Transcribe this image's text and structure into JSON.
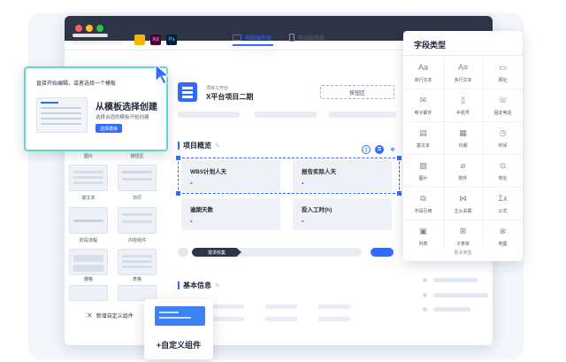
{
  "toolbar": {
    "apps": [
      {
        "name": "sketch",
        "label": "",
        "color": "#f7b500"
      },
      {
        "name": "xd",
        "label": "Xd",
        "color": "#470137"
      },
      {
        "name": "ps",
        "label": "Ps",
        "color": "#001e36"
      }
    ],
    "tabs": [
      {
        "label": "电脑端布局",
        "active": true
      },
      {
        "label": "移动端布局",
        "active": false
      }
    ]
  },
  "template_popup": {
    "hint": "直接开始编辑，或者选择一个模板",
    "title": "从模板选择创建",
    "description": "选择合适的模板开始创建",
    "button": "选择模板"
  },
  "palette": {
    "items": [
      {
        "label": "图片"
      },
      {
        "label": "按钮区"
      },
      {
        "label": "富文本"
      },
      {
        "label": "日历"
      },
      {
        "label": "阶段流程"
      },
      {
        "label": "内容组件"
      },
      {
        "label": "栅格"
      },
      {
        "label": "表格"
      }
    ],
    "custom_component": "新增自定义组件"
  },
  "form": {
    "subtitle": "项目工作台",
    "title": "X平台项目二期",
    "action_area": "按钮区",
    "section1": "项目概览",
    "metrics": [
      {
        "label": "WBS计划人天",
        "value": "-"
      },
      {
        "label": "报告实际人天",
        "value": "-"
      },
      {
        "label": "逾期天数",
        "value": "-"
      },
      {
        "label": "投入工时(h)",
        "value": "-"
      }
    ],
    "step_label": "需求收集",
    "section2": "基本信息"
  },
  "field_types": {
    "title": "字段类型",
    "items": [
      {
        "label": "单行文本",
        "icon": "Aa"
      },
      {
        "label": "多行文本",
        "icon": "A≡"
      },
      {
        "label": "网址",
        "icon": "▭"
      },
      {
        "label": "电子邮件",
        "icon": "✉"
      },
      {
        "label": "手机号",
        "icon": "▯"
      },
      {
        "label": "固定电话",
        "icon": "☏"
      },
      {
        "label": "富文本",
        "icon": "▤"
      },
      {
        "label": "日期",
        "icon": "▦"
      },
      {
        "label": "时间",
        "icon": "◷"
      },
      {
        "label": "图片",
        "icon": "▧"
      },
      {
        "label": "附件",
        "icon": "⌀"
      },
      {
        "label": "地址",
        "icon": "⊙"
      },
      {
        "label": "字段引用",
        "icon": "⧉"
      },
      {
        "label": "主从关联",
        "icon": "⋈"
      },
      {
        "label": "公式",
        "icon": "Σx"
      },
      {
        "label": "列表",
        "icon": "▣"
      },
      {
        "label": "子表单",
        "icon": "⊞"
      },
      {
        "label": "地图",
        "icon": "⊗"
      }
    ],
    "more": "更多类型"
  },
  "custom_card": {
    "label": "+自定义组件"
  }
}
